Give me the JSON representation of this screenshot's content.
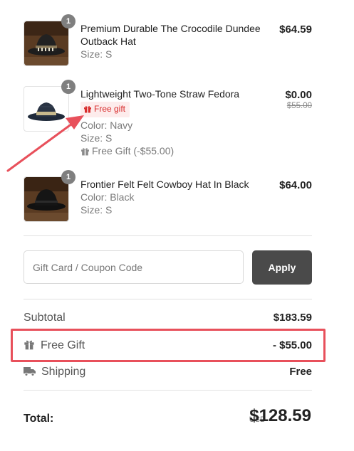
{
  "items": [
    {
      "title": "Premium Durable The Crocodile Dundee Outback Hat",
      "quantity": "1",
      "size": "Size: S",
      "price": "$64.59"
    },
    {
      "title": "Lightweight Two-Tone Straw Fedora",
      "quantity": "1",
      "badge": "Free gift",
      "color": "Color: Navy",
      "size": "Size: S",
      "free_gift_note": "Free Gift (-$55.00)",
      "price": "$0.00",
      "original_price": "$55.00"
    },
    {
      "title": "Frontier Felt Felt Cowboy Hat In Black",
      "quantity": "1",
      "color": "Color: Black",
      "size": "Size: S",
      "price": "$64.00"
    }
  ],
  "coupon": {
    "placeholder": "Gift Card / Coupon Code",
    "apply_label": "Apply"
  },
  "summary": {
    "subtotal_label": "Subtotal",
    "subtotal_value": "$183.59",
    "free_gift_label": "Free Gift",
    "free_gift_value": "- $55.00",
    "shipping_label": "Shipping",
    "shipping_value": "Free"
  },
  "total": {
    "label": "Total:",
    "currency": "USD",
    "value": "$128.59"
  },
  "colors": {
    "highlight": "#e8505b",
    "gift_red": "#d82c2c",
    "apply_button": "#4a4a4a"
  },
  "icons": [
    "gift-icon",
    "truck-icon",
    "arrow-annotation"
  ]
}
